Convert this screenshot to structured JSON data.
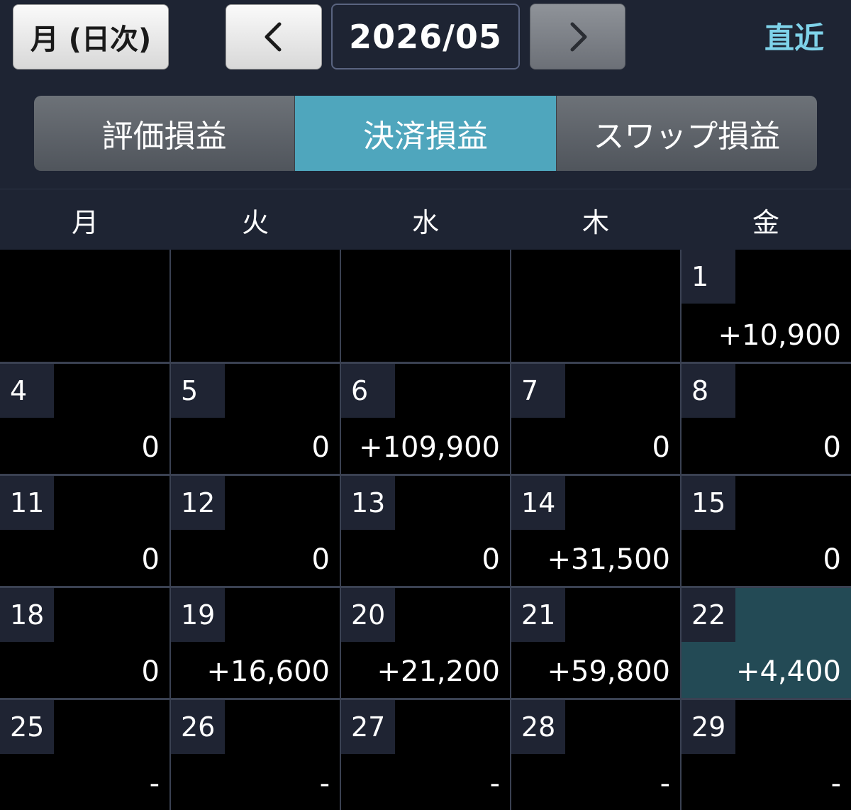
{
  "header": {
    "mode_label": "月 (日次)",
    "month": "2026/05",
    "latest_label": "直近"
  },
  "tabs": [
    {
      "label": "評価損益",
      "active": false
    },
    {
      "label": "決済損益",
      "active": true
    },
    {
      "label": "スワップ損益",
      "active": false
    }
  ],
  "weekdays": [
    "月",
    "火",
    "水",
    "木",
    "金"
  ],
  "weeks": [
    [
      {
        "day": "",
        "value": ""
      },
      {
        "day": "",
        "value": ""
      },
      {
        "day": "",
        "value": ""
      },
      {
        "day": "",
        "value": ""
      },
      {
        "day": "1",
        "value": "+10,900"
      }
    ],
    [
      {
        "day": "4",
        "value": "0"
      },
      {
        "day": "5",
        "value": "0"
      },
      {
        "day": "6",
        "value": "+109,900"
      },
      {
        "day": "7",
        "value": "0"
      },
      {
        "day": "8",
        "value": "0"
      }
    ],
    [
      {
        "day": "11",
        "value": "0"
      },
      {
        "day": "12",
        "value": "0"
      },
      {
        "day": "13",
        "value": "0"
      },
      {
        "day": "14",
        "value": "+31,500"
      },
      {
        "day": "15",
        "value": "0"
      }
    ],
    [
      {
        "day": "18",
        "value": "0"
      },
      {
        "day": "19",
        "value": "+16,600"
      },
      {
        "day": "20",
        "value": "+21,200"
      },
      {
        "day": "21",
        "value": "+59,800"
      },
      {
        "day": "22",
        "value": "+4,400",
        "today": true
      }
    ],
    [
      {
        "day": "25",
        "value": "-"
      },
      {
        "day": "26",
        "value": "-"
      },
      {
        "day": "27",
        "value": "-"
      },
      {
        "day": "28",
        "value": "-"
      },
      {
        "day": "29",
        "value": "-"
      }
    ]
  ],
  "colors": {
    "background": "#1e2433",
    "active_tab": "#4fa6bd",
    "today_cell": "#234a55",
    "latest_link": "#7fd3ea"
  }
}
